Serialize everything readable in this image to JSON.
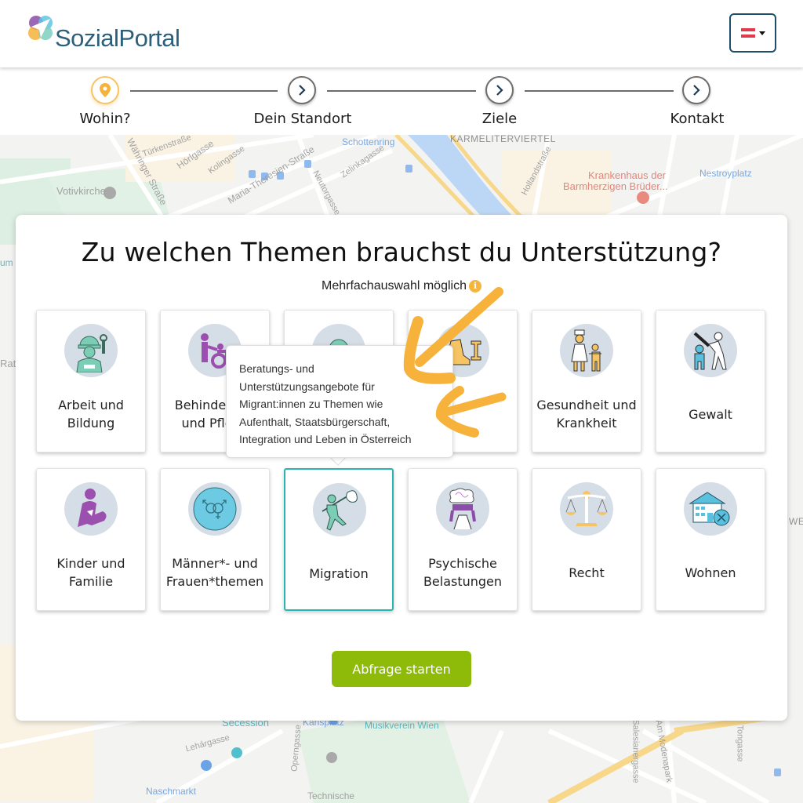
{
  "header": {
    "logo_text": "SozialPortal",
    "language_selector": {
      "selected": "Österreich",
      "flag_colors": [
        "#e03a4b",
        "#ffffff",
        "#e03a4b"
      ]
    }
  },
  "stepper": {
    "steps": [
      {
        "label": "Wohin?",
        "icon": "map-pin-icon",
        "active": true
      },
      {
        "label": "Dein Standort",
        "icon": "chevron-right-icon",
        "active": false
      },
      {
        "label": "Ziele",
        "icon": "chevron-right-icon",
        "active": false
      },
      {
        "label": "Kontakt",
        "icon": "chevron-right-icon",
        "active": false
      }
    ]
  },
  "map": {
    "labels": [
      "Türkenstraße",
      "Hörlgasse",
      "Kolingasse",
      "Maria-Theresien-Straße",
      "Währinger Straße",
      "Votivkirche",
      "Schottenring",
      "KARMELITERVIERTEL",
      "Hollandstraße",
      "Krankenhaus der",
      "Barmherzigen Brüder...",
      "Nestroyplatz",
      "Zelinkagasse",
      "Neutorgasse",
      "Secession",
      "Karlsplatz",
      "Musikverein Wien",
      "Lehárgasse",
      "Operngasse",
      "Naschmarkt",
      "Technische",
      "Salesianergasse",
      "Am Modenapark",
      "Tongasse",
      "Rat",
      "um",
      "WE"
    ]
  },
  "panel": {
    "title": "Zu welchen Themen brauchst du Unterstützung?",
    "subtitle": "Mehrfachauswahl möglich",
    "info_icon": "i",
    "topics": [
      {
        "label": "Arbeit und Bildung",
        "icon": "worker-icon",
        "selected": false
      },
      {
        "label": "Behinderung und Pflege",
        "icon": "wheelchair-care-icon",
        "selected": false,
        "visible_label": "Behinde\nund Pfl"
      },
      {
        "label": "",
        "icon": "person-icon",
        "selected": false
      },
      {
        "label": "",
        "icon": "sport-shoe-icon",
        "selected": false
      },
      {
        "label": "Gesundheit und Krankheit",
        "icon": "doctor-child-icon",
        "selected": false
      },
      {
        "label": "Gewalt",
        "icon": "violence-icon",
        "selected": false
      },
      {
        "label": "Kinder und Familie",
        "icon": "parent-child-icon",
        "selected": false
      },
      {
        "label": "Männer*- und Frauen*themen",
        "icon": "gender-symbol-icon",
        "selected": false
      },
      {
        "label": "Migration",
        "icon": "migrant-bundle-icon",
        "selected": true
      },
      {
        "label": "Psychische Belastungen",
        "icon": "stressed-mind-icon",
        "selected": false
      },
      {
        "label": "Recht",
        "icon": "scales-icon",
        "selected": false
      },
      {
        "label": "Wohnen",
        "icon": "house-cancel-icon",
        "selected": false
      }
    ],
    "tooltip_lines": [
      "Beratungs- und",
      "Unterstützungsangebote für",
      "Migrant:innen zu Themen wie",
      "Aufenthalt, Staatsbürgerschaft,",
      "Integration und Leben in Österreich"
    ],
    "start_button": "Abfrage starten"
  },
  "colors": {
    "accent_orange": "#f6b23a",
    "selected_border": "#2bb5b0",
    "start_button": "#8ebb0a",
    "logo_text": "#2c5f7c"
  }
}
